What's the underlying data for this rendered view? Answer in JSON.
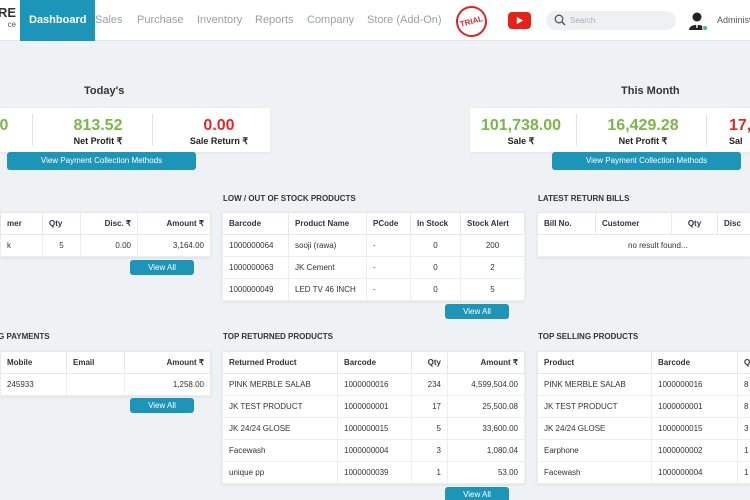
{
  "header": {
    "logo_main": "RE",
    "logo_sub": "ce",
    "nav": [
      "Dashboard",
      "Sales",
      "Purchase",
      "Inventory",
      "Reports",
      "Company",
      "Store (Add-On)"
    ],
    "trial_badge": "TRIAL",
    "search_placeholder": "Search",
    "admin_label": "Administ"
  },
  "today": {
    "title": "Today's",
    "stats": [
      {
        "value": "0",
        "label": ""
      },
      {
        "value": "813.52",
        "label": "Net Profit ₹"
      },
      {
        "value": "0.00",
        "label": "Sale Return ₹"
      }
    ],
    "button": "View Payment Collection Methods"
  },
  "month": {
    "title": "This Month",
    "stats": [
      {
        "value": "101,738.00",
        "label": "Sale ₹"
      },
      {
        "value": "16,429.28",
        "label": "Net Profit ₹"
      },
      {
        "value": "17,",
        "label": "Sal"
      }
    ],
    "button": "View Payment Collection Methods"
  },
  "recent_sales": {
    "headers": [
      "mer",
      "Qty",
      "Disc. ₹",
      "Amount ₹"
    ],
    "rows": [
      [
        "k",
        "5",
        "0.00",
        "3,164.00"
      ]
    ],
    "button": "View All"
  },
  "low_stock": {
    "title": "LOW / OUT OF STOCK PRODUCTS",
    "headers": [
      "Barcode",
      "Product Name",
      "PCode",
      "In Stock",
      "Stock Alert"
    ],
    "rows": [
      [
        "1000000064",
        "sooji (rawa)",
        "-",
        "0",
        "200"
      ],
      [
        "1000000063",
        "JK Cement",
        "-",
        "0",
        "2"
      ],
      [
        "1000000049",
        "LED TV 46 INCH",
        "-",
        "0",
        "5"
      ]
    ],
    "button": "View All"
  },
  "latest_returns": {
    "title": "LATEST RETURN BILLS",
    "headers": [
      "Bill No.",
      "Customer",
      "Qty",
      "Disc"
    ],
    "empty": "no result found..."
  },
  "pending_payments": {
    "title": "G PAYMENTS",
    "headers": [
      "Mobile",
      "Email",
      "Amount ₹"
    ],
    "rows": [
      [
        "245933",
        "",
        "1,258.00"
      ]
    ],
    "button": "View All"
  },
  "top_returned": {
    "title": "TOP RETURNED PRODUCTS",
    "headers": [
      "Returned Product",
      "Barcode",
      "Qty",
      "Amount ₹"
    ],
    "rows": [
      [
        "PINK MERBLE SALAB",
        "1000000016",
        "234",
        "4,599,504.00"
      ],
      [
        "JK TEST PRODUCT",
        "1000000001",
        "17",
        "25,500.08"
      ],
      [
        "JK 24/24 GLOSE",
        "1000000015",
        "5",
        "33,600.00"
      ],
      [
        "Facewash",
        "1000000004",
        "3",
        "1,080.04"
      ],
      [
        "unique pp",
        "1000000039",
        "1",
        "53.00"
      ]
    ],
    "button": "View All"
  },
  "top_selling": {
    "title": "TOP SELLING PRODUCTS",
    "headers": [
      "Product",
      "Barcode",
      "Q"
    ],
    "rows": [
      [
        "PINK MERBLE SALAB",
        "1000000016",
        "8"
      ],
      [
        "JK TEST PRODUCT",
        "1000000001",
        "8"
      ],
      [
        "JK 24/24 GLOSE",
        "1000000015",
        "3"
      ],
      [
        "Earphone",
        "1000000002",
        "1"
      ],
      [
        "Facewash",
        "1000000004",
        "1"
      ]
    ]
  },
  "colors": {
    "accent": "#1c95b8",
    "positive": "#7ab648",
    "negative": "#e02a2a"
  }
}
